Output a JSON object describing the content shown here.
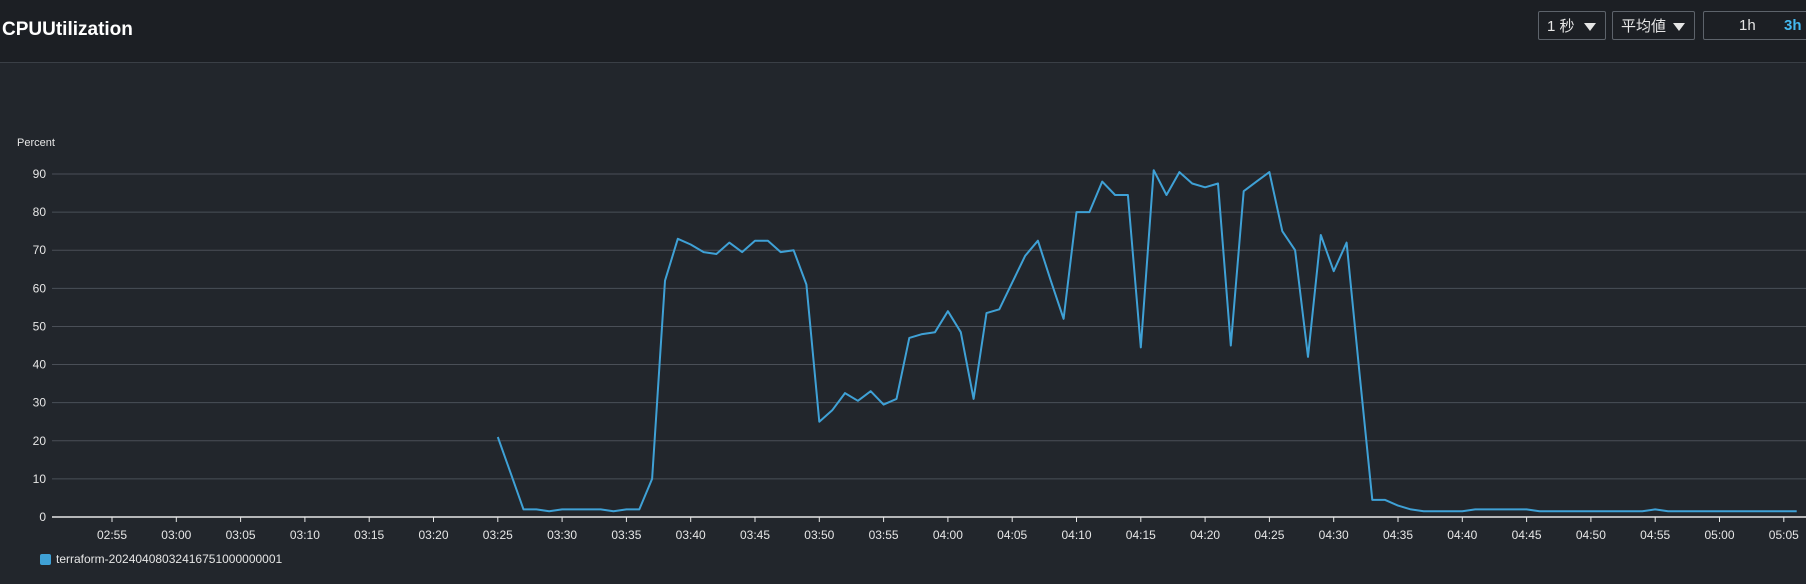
{
  "header": {
    "title": "CPUUtilization",
    "period_label": "1 秒",
    "stat_label": "平均値",
    "range_options": [
      "1h",
      "3h"
    ],
    "selected_range": "3h"
  },
  "colors": {
    "background": "#22262c",
    "header_bg": "#1c1f24",
    "series": "#3fa1d6",
    "gridline": "#4a4f57",
    "selected_range": "#44b9f0"
  },
  "chart_data": {
    "type": "line",
    "ylabel": "Percent",
    "ylim": [
      0,
      90
    ],
    "yticks": [
      0,
      10,
      20,
      30,
      40,
      50,
      60,
      70,
      80,
      90
    ],
    "xticks": [
      "02:55",
      "03:00",
      "03:05",
      "03:10",
      "03:15",
      "03:20",
      "03:25",
      "03:30",
      "03:35",
      "03:40",
      "03:45",
      "03:50",
      "03:55",
      "04:00",
      "04:05",
      "04:10",
      "04:15",
      "04:20",
      "04:25",
      "04:30",
      "04:35",
      "04:40",
      "04:45",
      "04:50",
      "04:55",
      "05:00",
      "05:05"
    ],
    "grid": true,
    "legend_position": "bottom-left",
    "series": [
      {
        "name": "terraform-20240408032416751000000001",
        "x": [
          "03:25",
          "03:26",
          "03:27",
          "03:28",
          "03:29",
          "03:30",
          "03:31",
          "03:32",
          "03:33",
          "03:34",
          "03:35",
          "03:36",
          "03:37",
          "03:38",
          "03:39",
          "03:40",
          "03:41",
          "03:42",
          "03:43",
          "03:44",
          "03:45",
          "03:46",
          "03:47",
          "03:48",
          "03:49",
          "03:50",
          "03:51",
          "03:52",
          "03:53",
          "03:54",
          "03:55",
          "03:56",
          "03:57",
          "03:58",
          "03:59",
          "04:00",
          "04:01",
          "04:02",
          "04:03",
          "04:04",
          "04:05",
          "04:06",
          "04:07",
          "04:08",
          "04:09",
          "04:10",
          "04:11",
          "04:12",
          "04:13",
          "04:14",
          "04:15",
          "04:16",
          "04:17",
          "04:18",
          "04:19",
          "04:20",
          "04:21",
          "04:22",
          "04:23",
          "04:24",
          "04:25",
          "04:26",
          "04:27",
          "04:28",
          "04:29",
          "04:30",
          "04:31",
          "04:32",
          "04:33",
          "04:34",
          "04:35",
          "04:36",
          "04:37",
          "04:38",
          "04:39",
          "04:40",
          "04:41",
          "04:42",
          "04:43",
          "04:44",
          "04:45",
          "04:46",
          "04:47",
          "04:48",
          "04:49",
          "04:50",
          "04:51",
          "04:52",
          "04:53",
          "04:54",
          "04:55",
          "04:56",
          "04:57",
          "04:58",
          "04:59",
          "05:00",
          "05:01",
          "05:02",
          "05:03",
          "05:04",
          "05:05",
          "05:06"
        ],
        "y": [
          21,
          11.5,
          2,
          2,
          1.5,
          2,
          2,
          2,
          2,
          1.5,
          2,
          2,
          10,
          62,
          73,
          71.5,
          69.5,
          69,
          72,
          69.5,
          72.5,
          72.5,
          69.5,
          70,
          61,
          25,
          28,
          32.5,
          30.5,
          33,
          29.5,
          31,
          47,
          48,
          48.5,
          54,
          48.5,
          31,
          53.5,
          54.5,
          61.5,
          68.5,
          72.5,
          62,
          52,
          80,
          80,
          88,
          84.5,
          84.5,
          44.5,
          91,
          84.5,
          90.5,
          87.5,
          86.5,
          87.5,
          45,
          85.5,
          88,
          90.5,
          75,
          70,
          42,
          74,
          64.5,
          72,
          38,
          4.5,
          4.5,
          3,
          2,
          1.5,
          1.5,
          1.5,
          1.5,
          2,
          2,
          2,
          2,
          2,
          1.5,
          1.5,
          1.5,
          1.5,
          1.5,
          1.5,
          1.5,
          1.5,
          1.5,
          2,
          1.5,
          1.5,
          1.5,
          1.5,
          1.5,
          1.5,
          1.5,
          1.5,
          1.5,
          1.5,
          1.5
        ]
      }
    ]
  }
}
